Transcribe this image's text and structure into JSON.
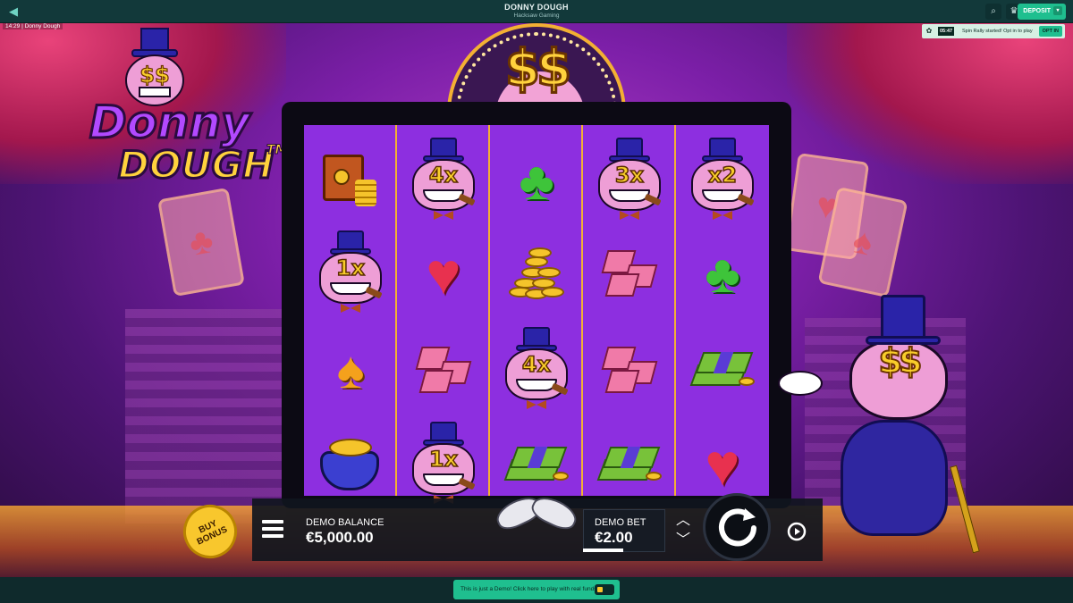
{
  "topbar": {
    "title": "DONNY DOUGH",
    "provider": "Hacksaw Gaming",
    "deposit_label": "DEPOSIT"
  },
  "status": {
    "time": "14:29",
    "page_label": "Donny Dough"
  },
  "rally": {
    "timer": "05:47",
    "message": "Spin Rally started! Opt in to play",
    "opt_in_label": "OPT IN"
  },
  "logo": {
    "line1": "Donny",
    "line2": "DOUGH",
    "tm": "TM"
  },
  "emblem": {
    "eyes": "$$"
  },
  "reels": [
    [
      "safe",
      "donny-1x",
      "spade",
      "purse"
    ],
    [
      "donny-4x",
      "heart",
      "gems",
      "donny-1x"
    ],
    [
      "club",
      "coins",
      "donny-4x",
      "cash"
    ],
    [
      "donny-3x",
      "gems",
      "gems",
      "cash"
    ],
    [
      "donny-x2",
      "club",
      "cash",
      "heart"
    ]
  ],
  "multipliers": {
    "donny-1x": "1x",
    "donny-3x": "3x",
    "donny-4x": "4x",
    "donny-x2": "x2"
  },
  "controls": {
    "buy_bonus": "BUY BONUS",
    "balance_label": "DEMO BALANCE",
    "balance_value": "€5,000.00",
    "bet_label": "DEMO BET",
    "bet_value": "€2.00"
  },
  "character": {
    "eyes": "$$"
  },
  "footer": {
    "demo_notice": "This is just a Demo! Click here to play with real funds."
  },
  "colors": {
    "accent": "#1fbf8f",
    "topbar": "#12393a",
    "reel_bg": "#8d2fe0",
    "reel_separator": "#f3b033",
    "buy_bonus": "#f8c72d"
  }
}
